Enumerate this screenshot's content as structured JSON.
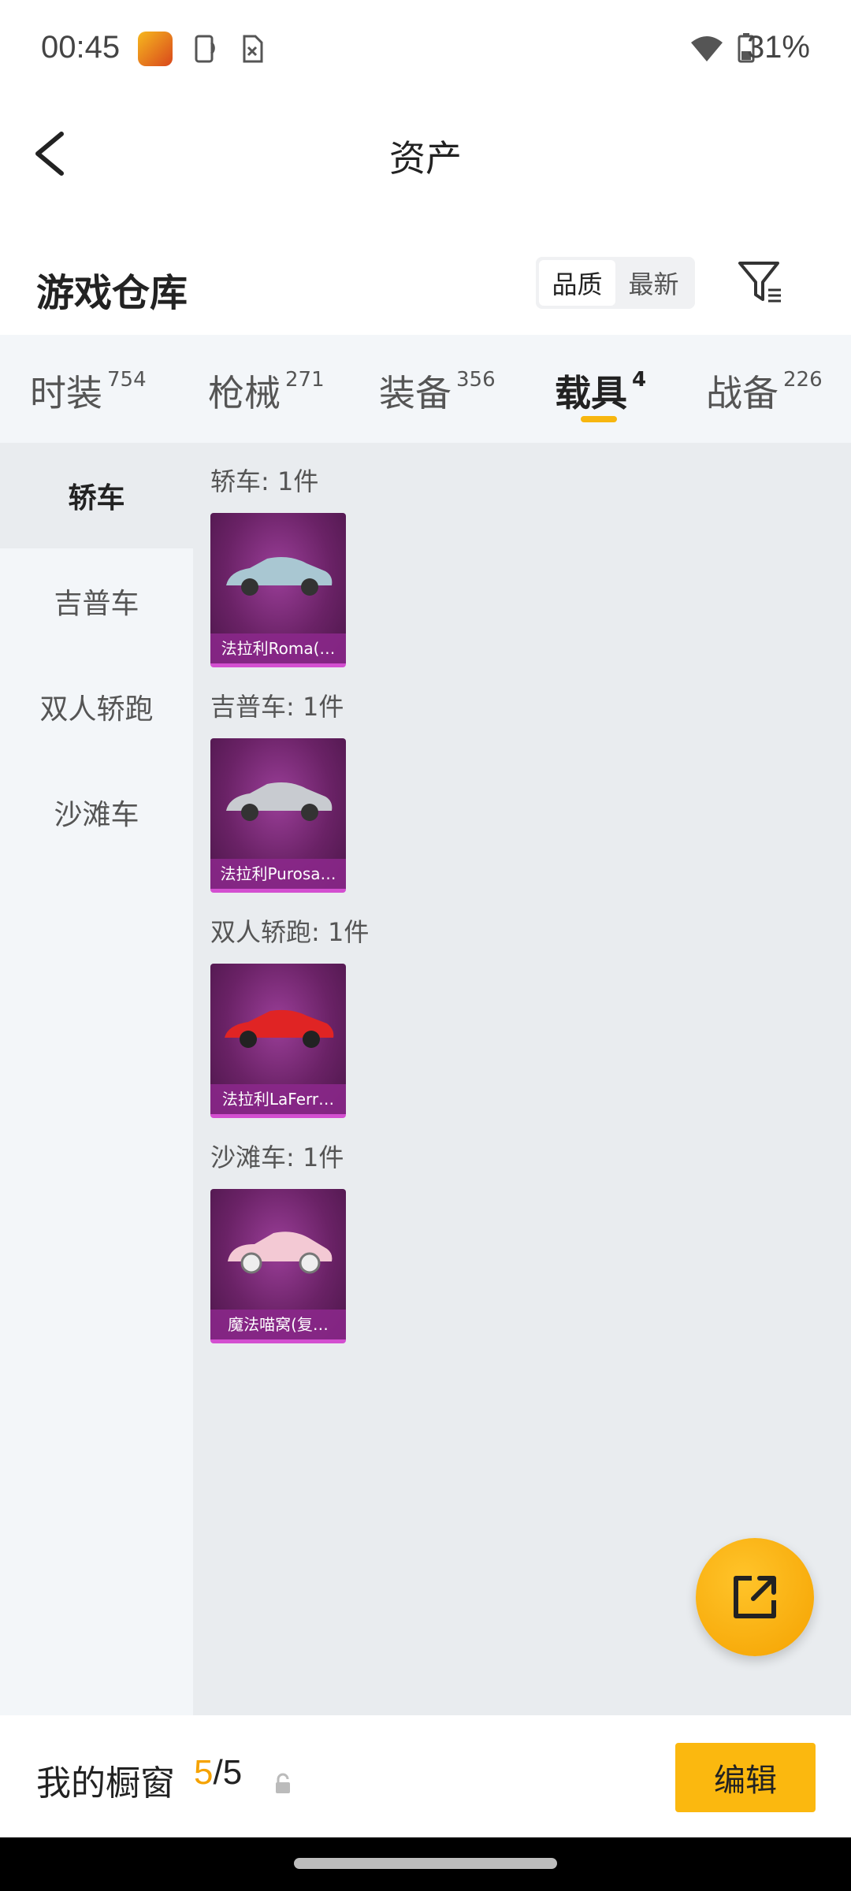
{
  "status_bar": {
    "time": "00:45",
    "battery": "31%",
    "icons": [
      "app-icon",
      "screen-rotate-icon",
      "no-sim-icon",
      "wifi-icon",
      "battery-icon"
    ]
  },
  "header": {
    "title": "资产"
  },
  "warehouse": {
    "title": "游戏仓库",
    "sort_options": [
      "品质",
      "最新"
    ],
    "active_sort": "品质"
  },
  "tabs": [
    {
      "label": "时装",
      "count": "754"
    },
    {
      "label": "枪械",
      "count": "271"
    },
    {
      "label": "装备",
      "count": "356"
    },
    {
      "label": "载具",
      "count": "4",
      "active": true
    },
    {
      "label": "战备",
      "count": "226"
    }
  ],
  "side_menu": [
    "轿车",
    "吉普车",
    "双人轿跑",
    "沙滩车"
  ],
  "groups": [
    {
      "title": "轿车: 1件",
      "item": "法拉利Roma(…",
      "car_color": "#a9c7d2"
    },
    {
      "title": "吉普车: 1件",
      "item": "法拉利Purosa…",
      "car_color": "#c8cbd0"
    },
    {
      "title": "双人轿跑: 1件",
      "item": "法拉利LaFerr…",
      "car_color": "#e02424"
    },
    {
      "title": "沙滩车: 1件",
      "item": "魔法喵窝(复…",
      "car_color": "#f3c9d4"
    }
  ],
  "bottom": {
    "label": "我的橱窗",
    "count_current": "5",
    "count_sep_total": "/5",
    "edit_label": "编辑"
  },
  "colors": {
    "accent": "#fbb80f",
    "card_purple": "#6a2266"
  }
}
